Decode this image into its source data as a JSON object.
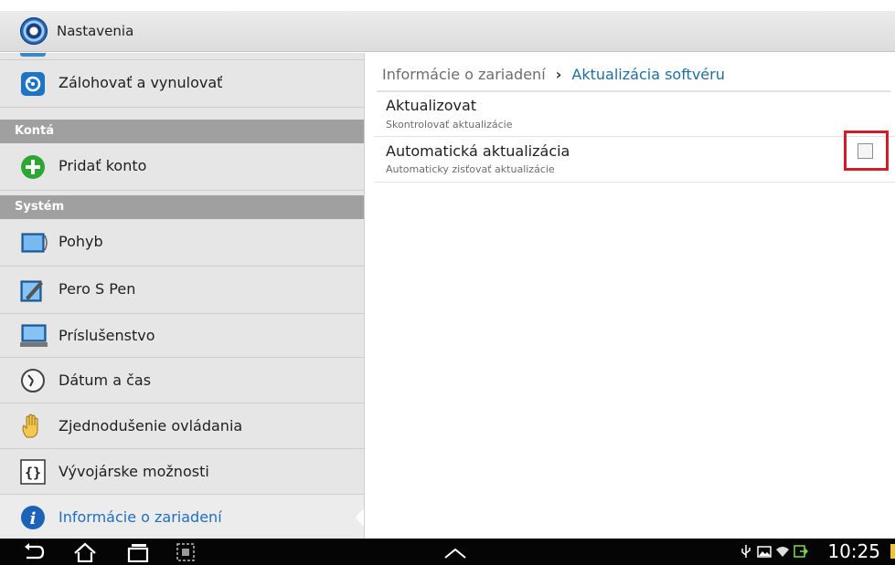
{
  "app": {
    "title": "Nastavenia"
  },
  "sidebar": {
    "items": [
      {
        "label": "Zálohovať a vynulovať",
        "icon": "backup-reset-icon"
      },
      {
        "label": "Pridať konto",
        "icon": "add-account-icon"
      },
      {
        "label": "Pohyb",
        "icon": "motion-icon"
      },
      {
        "label": "Pero S Pen",
        "icon": "s-pen-icon"
      },
      {
        "label": "Príslušenstvo",
        "icon": "accessory-icon"
      },
      {
        "label": "Dátum a čas",
        "icon": "clock-icon"
      },
      {
        "label": "Zjednodušenie ovládania",
        "icon": "hand-icon"
      },
      {
        "label": "Vývojárske možnosti",
        "icon": "developer-braces-icon"
      },
      {
        "label": "Informácie o zariadení",
        "icon": "info-icon",
        "selected": true
      }
    ],
    "headers": {
      "accounts": "Kontá",
      "system": "Systém"
    }
  },
  "breadcrumb": {
    "parent": "Informácie o zariadení",
    "separator": "›",
    "current": "Aktualizácia softvéru"
  },
  "prefs": [
    {
      "title": "Aktualizovat",
      "summary": "Skontrolovať aktualizácie"
    },
    {
      "title": "Automatická aktualizácia",
      "summary": "Automaticky zisťovať aktualizácie",
      "checked": false
    }
  ],
  "statusbar": {
    "time": "10:25"
  },
  "colors": {
    "accent": "#1e6fbf",
    "highlight": "#d61b28"
  }
}
